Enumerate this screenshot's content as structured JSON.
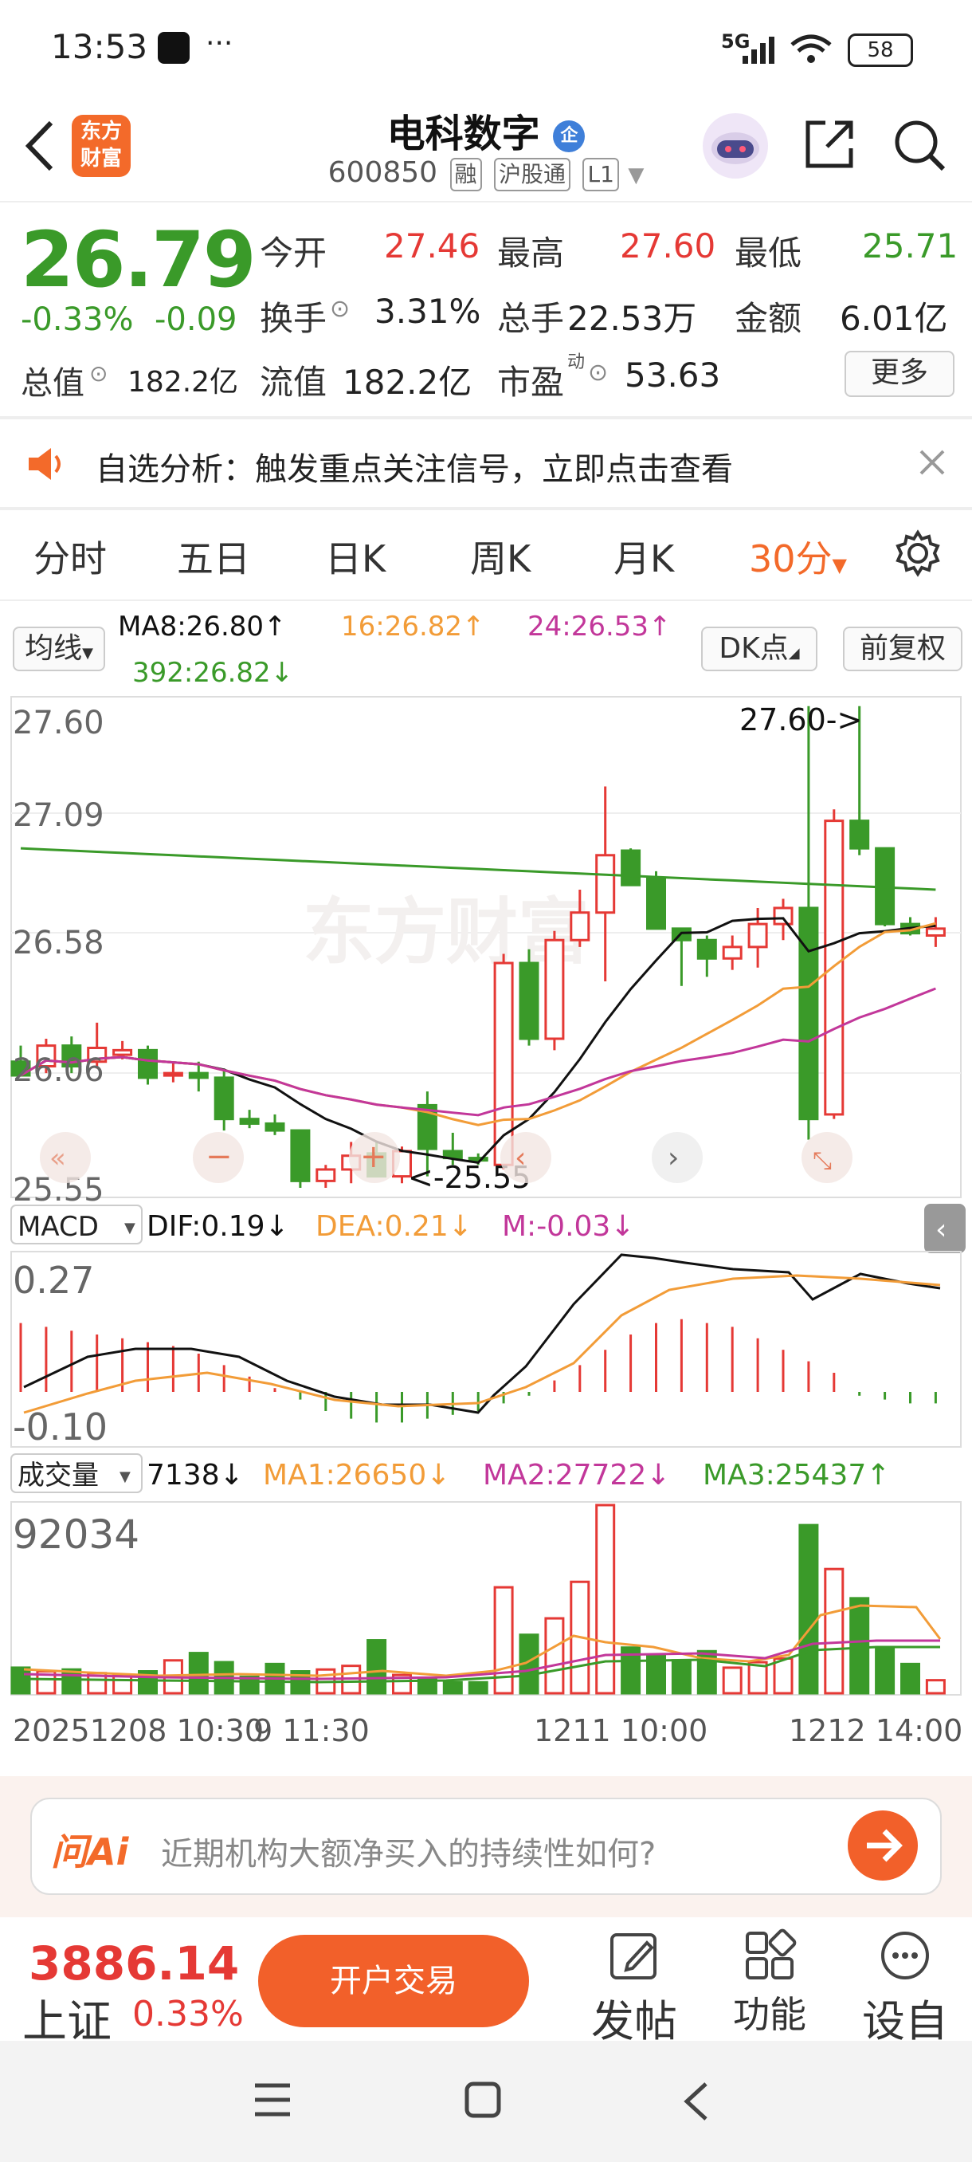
{
  "status": {
    "time": "13:53",
    "more": "···",
    "network": "5G",
    "battery": "58"
  },
  "header": {
    "logo_line1": "东方",
    "logo_line2": "财富",
    "title": "电科数字",
    "badge": "企",
    "code": "600850",
    "tags": [
      "融",
      "沪股通",
      "L1"
    ]
  },
  "quote": {
    "price": "26.79",
    "change_pct": "-0.33%",
    "change": "-0.09",
    "open_label": "今开",
    "open": "27.46",
    "high_label": "最高",
    "high": "27.60",
    "low_label": "最低",
    "low": "25.71",
    "turnover_label": "换手",
    "turnover": "3.31%",
    "volume_label": "总手",
    "volume": "22.53万",
    "amount_label": "金额",
    "amount": "6.01亿",
    "mktcap_label": "总值",
    "mktcap": "182.2亿",
    "float_label": "流值",
    "float": "182.2亿",
    "pe_label": "市盈",
    "pe_sup": "动",
    "pe": "53.63",
    "more_button": "更多"
  },
  "notice": {
    "text": "自选分析：触发重点关注信号，立即点击查看"
  },
  "tabs": [
    "分时",
    "五日",
    "日K",
    "周K",
    "月K",
    "30分"
  ],
  "ma_legend": {
    "selector": "均线",
    "ma8": "MA8:26.80↑",
    "ma16": "16:26.82↑",
    "ma24": "24:26.53↑",
    "ma392": "392:26.82↓",
    "dk_button": "DK点",
    "adjust_button": "前复权"
  },
  "colors": {
    "up": "#e53935",
    "down": "#3a9a29",
    "ma8": "#111111",
    "ma16": "#f29c38",
    "ma24": "#c2379a",
    "ma392": "#3a9a29",
    "accent": "#f36a2a"
  },
  "chart_data": [
    {
      "type": "candlestick",
      "title": "30分",
      "yticks": [
        "27.60",
        "27.09",
        "26.58",
        "26.06",
        "25.55"
      ],
      "annotations": [
        "27.60->",
        "<-25.55"
      ],
      "ohlc": [
        [
          26.05,
          26.12,
          25.99,
          25.99
        ],
        [
          26.03,
          26.15,
          26.0,
          26.12
        ],
        [
          26.12,
          26.16,
          26.0,
          26.03
        ],
        [
          26.05,
          26.22,
          26.02,
          26.11
        ],
        [
          26.08,
          26.14,
          26.06,
          26.1
        ],
        [
          26.1,
          26.12,
          25.95,
          25.98
        ],
        [
          26.0,
          26.05,
          25.96,
          26.0
        ],
        [
          26.0,
          26.05,
          25.92,
          25.98
        ],
        [
          25.98,
          26.02,
          25.75,
          25.8
        ],
        [
          25.8,
          25.84,
          25.76,
          25.78
        ],
        [
          25.78,
          25.82,
          25.73,
          25.75
        ],
        [
          25.75,
          25.72,
          25.5,
          25.53
        ],
        [
          25.53,
          25.6,
          25.5,
          25.58
        ],
        [
          25.58,
          25.7,
          25.52,
          25.64
        ],
        [
          25.65,
          25.7,
          25.55,
          25.55
        ],
        [
          25.55,
          25.68,
          25.52,
          25.66
        ],
        [
          25.86,
          25.92,
          25.55,
          25.67
        ],
        [
          25.66,
          25.74,
          25.6,
          25.63
        ],
        [
          25.63,
          25.65,
          25.6,
          25.62
        ],
        [
          25.6,
          26.52,
          25.58,
          26.48
        ],
        [
          26.48,
          26.54,
          26.12,
          26.15
        ],
        [
          26.15,
          26.62,
          26.1,
          26.58
        ],
        [
          26.58,
          26.8,
          26.55,
          26.7
        ],
        [
          26.7,
          27.25,
          26.4,
          26.95
        ],
        [
          26.97,
          26.98,
          26.82,
          26.82
        ],
        [
          26.85,
          26.88,
          26.63,
          26.63
        ],
        [
          26.63,
          26.58,
          26.38,
          26.58
        ],
        [
          26.58,
          26.6,
          26.42,
          26.5
        ],
        [
          26.5,
          26.6,
          26.45,
          26.55
        ],
        [
          26.55,
          26.72,
          26.46,
          26.65
        ],
        [
          26.65,
          26.76,
          26.58,
          26.72
        ],
        [
          26.72,
          27.6,
          25.71,
          25.8
        ],
        [
          25.82,
          27.15,
          25.8,
          27.1
        ],
        [
          27.1,
          27.6,
          26.95,
          26.98
        ],
        [
          26.98,
          26.98,
          26.64,
          26.65
        ],
        [
          26.65,
          26.68,
          26.6,
          26.61
        ],
        [
          26.6,
          26.68,
          26.55,
          26.63
        ]
      ],
      "ma8_line": "rising from 25.6 to 26.79",
      "xlabels": [
        "20251208 10:30",
        "9 11:30",
        "1211 10:00",
        "1212 14:00"
      ]
    },
    {
      "type": "bar",
      "title": "MACD",
      "legend": [
        "DIF:0.19↓",
        "DEA:0.21↓",
        "M:-0.03↓"
      ],
      "yticks": [
        "0.27",
        "-0.10"
      ],
      "m_values": [
        0.18,
        0.17,
        0.16,
        0.15,
        0.14,
        0.13,
        0.12,
        0.1,
        0.07,
        0.04,
        0.01,
        -0.02,
        -0.05,
        -0.07,
        -0.08,
        -0.08,
        -0.07,
        -0.06,
        -0.05,
        -0.03,
        -0.01,
        0.03,
        0.07,
        0.11,
        0.15,
        0.18,
        0.19,
        0.18,
        0.17,
        0.14,
        0.11,
        0.08,
        0.05,
        -0.01,
        -0.02,
        -0.03,
        -0.03
      ]
    },
    {
      "type": "bar",
      "title": "成交量",
      "legend": [
        "7138↓",
        "MA1:26650↓",
        "MA2:27722↓",
        "MA3:25437↑"
      ],
      "ytick": "92034",
      "values": [
        14000,
        12000,
        13000,
        11000,
        10000,
        12000,
        18000,
        22000,
        17000,
        9000,
        16000,
        12000,
        13000,
        15000,
        29000,
        10000,
        8000,
        6000,
        6000,
        58000,
        32000,
        41000,
        61000,
        103000,
        25000,
        21000,
        18000,
        23000,
        14000,
        17000,
        19000,
        92034,
        68000,
        52000,
        24000,
        16000,
        7138
      ]
    }
  ],
  "ai_bar": {
    "logo": "问Ai",
    "text": "近期机构大额净买入的持续性如何?"
  },
  "bottom": {
    "index_value": "3886.14",
    "index_name": "上证",
    "index_change": "0.33%",
    "trade_button": "开户交易",
    "post": "发帖",
    "function": "功能",
    "settings": "设自"
  }
}
